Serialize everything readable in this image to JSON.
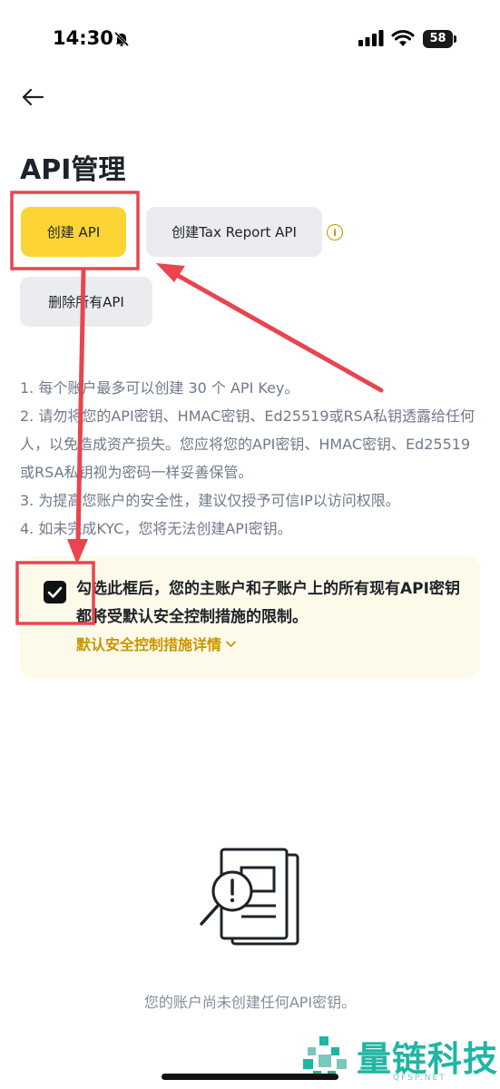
{
  "status_bar": {
    "time": "14:30",
    "battery": "58",
    "icons": [
      "bell-slash-icon",
      "cellular-signal-icon",
      "wifi-icon",
      "battery-icon"
    ]
  },
  "header": {
    "back_icon": "arrow-left-icon",
    "title": "API管理"
  },
  "actions": {
    "create_label": "创建 API",
    "create_tax_label": "创建Tax Report API",
    "delete_all_label": "删除所有API",
    "info_icon": "info-circle-icon"
  },
  "notes": [
    "1. 每个账户最多可以创建 30 个 API Key。",
    "2. 请勿将您的API密钥、HMAC密钥、Ed25519或RSA私钥透露给任何人，以免造成资产损失。您应将您的API密钥、HMAC密钥、Ed25519或RSA私钥视为密码一样妥善保管。",
    "3. 为提高您账户的安全性，建议仅授予可信IP以访问权限。",
    "4. 如未完成KYC，您将无法创建API密钥。"
  ],
  "security_notice": {
    "checked": true,
    "text": "勾选此框后，您的主账户和子账户上的所有现有API密钥都将受默认安全控制措施的限制。",
    "link_label": "默认安全控制措施详情"
  },
  "empty_state": {
    "icon": "document-warning-icon",
    "text": "您的账户尚未创建任何API密钥。"
  },
  "watermark": {
    "text": "量链科技",
    "sub": "QFSP.NET"
  },
  "colors": {
    "primary": "#fcd535",
    "secondary_button": "#eaecef",
    "accent_text": "#c99400",
    "notice_bg": "#fefaea",
    "annotation": "#e8454f",
    "watermark": "#1fb6a3"
  }
}
